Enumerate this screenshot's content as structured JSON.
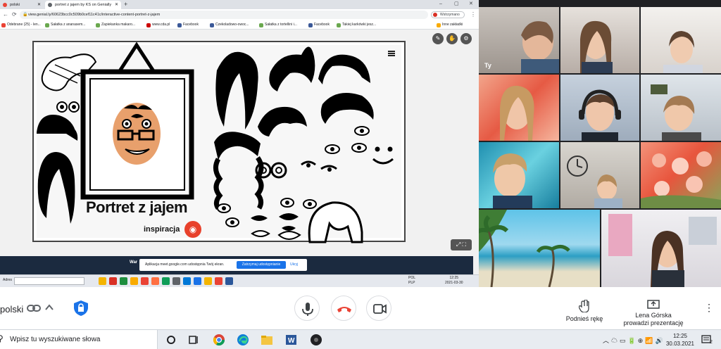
{
  "browser": {
    "tabs": [
      {
        "label": "polski"
      },
      {
        "label": "portret z jajem by KS on Genially"
      }
    ],
    "new_tab": "+",
    "window_controls": [
      "–",
      "▢",
      "✕"
    ],
    "url": "view.genial.ly/60623bcc0c509b0cef11c41c/interactive-content-portret-z-jajem",
    "paused_label": "Wstrzymano",
    "bookmarks": [
      "Odebrane (25) - len...",
      "Sałatka z ananasem...",
      "Zapiekanka makaro...",
      "www.cda.pl",
      "Facebook",
      "Czekoladowo-owoc...",
      "Sałatka z tortellini i...",
      "Facebook",
      "Takiej karkówki jesz...",
      "Inne zakładki"
    ]
  },
  "slide": {
    "title": "Portret z jajem",
    "inspiration_label": "inspiracja"
  },
  "share_notice": {
    "warn_prefix": "War",
    "message": "Aplikacja meet.google.com udostępnia Twój ekran.",
    "stop_label": "Zatrzymaj udostępnianie",
    "hide_label": "Ukryj"
  },
  "inner_taskbar": {
    "address_label": "Adres",
    "tray_lang": "POL\nPLP",
    "time": "12:25",
    "date": "2021-03-30"
  },
  "participants": {
    "self_label": "Ty"
  },
  "meet": {
    "language": "polski",
    "raise_hand": "Podnieś rękę",
    "presenter_name": "Lena Górska",
    "presenting_label": "prowadzi prezentację"
  },
  "windows": {
    "search_placeholder": "Wpisz tu wyszukiwane słowa",
    "time": "12:25",
    "date": "30.03.2021",
    "notification_count": "2"
  },
  "colors": {
    "meet_red": "#ea4335",
    "chrome_blue": "#1a73e8",
    "genially_red": "#e8412b",
    "speaking_border": "#1e8e3e"
  }
}
